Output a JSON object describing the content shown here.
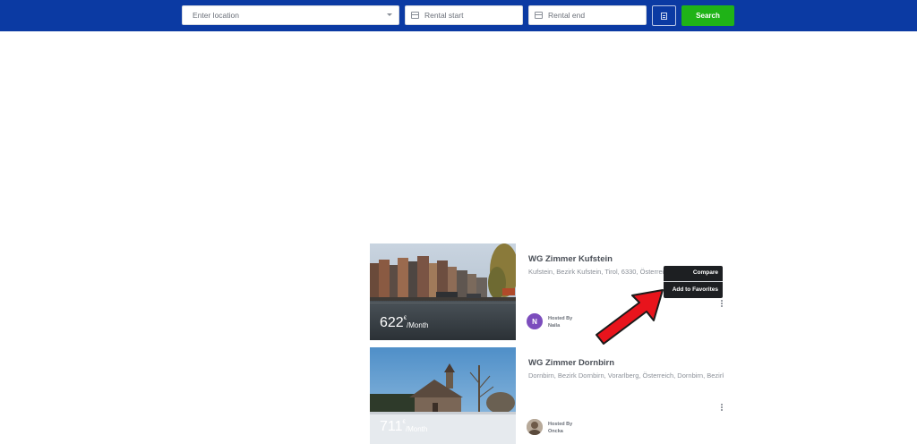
{
  "search": {
    "location_placeholder": "Enter location",
    "rental_start_placeholder": "Rental start",
    "rental_end_placeholder": "Rental end",
    "search_label": "Search"
  },
  "listings": [
    {
      "title": "WG Zimmer Kufstein",
      "address": "Kufstein, Bezirk Kufstein, Tirol, 6330, Österreich",
      "price": "622",
      "currency": "€",
      "period": "/Month",
      "hosted_by_label": "Hosted By",
      "host_name": "Naila",
      "avatar_initial": "N"
    },
    {
      "title": "WG Zimmer Dornbirn",
      "address": "Dornbirn, Bezirk Dornbirn, Vorarlberg, Österreich, Dornbirn, Bezirk",
      "price": "711",
      "currency": "€",
      "period": "/Month",
      "hosted_by_label": "Hosted By",
      "host_name": "Oncka"
    }
  ],
  "context_menu": {
    "compare_label": "Compare",
    "favorites_label": "Add to Favorites"
  },
  "colors": {
    "header_bg": "#0b3aa3",
    "search_button": "#1fb317",
    "annotation_arrow": "#e8141c"
  }
}
